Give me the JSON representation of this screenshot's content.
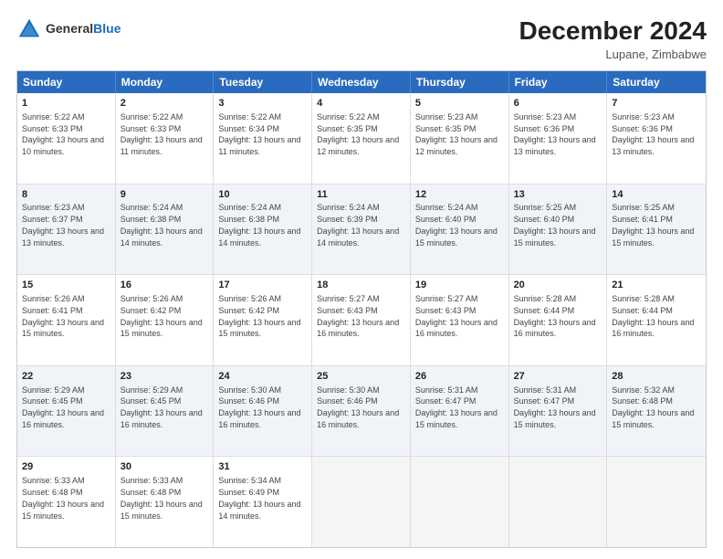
{
  "header": {
    "logo_general": "General",
    "logo_blue": "Blue",
    "month_title": "December 2024",
    "location": "Lupane, Zimbabwe"
  },
  "weekdays": [
    "Sunday",
    "Monday",
    "Tuesday",
    "Wednesday",
    "Thursday",
    "Friday",
    "Saturday"
  ],
  "rows": [
    [
      {
        "day": "1",
        "sunrise": "Sunrise: 5:22 AM",
        "sunset": "Sunset: 6:33 PM",
        "daylight": "Daylight: 13 hours and 10 minutes."
      },
      {
        "day": "2",
        "sunrise": "Sunrise: 5:22 AM",
        "sunset": "Sunset: 6:33 PM",
        "daylight": "Daylight: 13 hours and 11 minutes."
      },
      {
        "day": "3",
        "sunrise": "Sunrise: 5:22 AM",
        "sunset": "Sunset: 6:34 PM",
        "daylight": "Daylight: 13 hours and 11 minutes."
      },
      {
        "day": "4",
        "sunrise": "Sunrise: 5:22 AM",
        "sunset": "Sunset: 6:35 PM",
        "daylight": "Daylight: 13 hours and 12 minutes."
      },
      {
        "day": "5",
        "sunrise": "Sunrise: 5:23 AM",
        "sunset": "Sunset: 6:35 PM",
        "daylight": "Daylight: 13 hours and 12 minutes."
      },
      {
        "day": "6",
        "sunrise": "Sunrise: 5:23 AM",
        "sunset": "Sunset: 6:36 PM",
        "daylight": "Daylight: 13 hours and 13 minutes."
      },
      {
        "day": "7",
        "sunrise": "Sunrise: 5:23 AM",
        "sunset": "Sunset: 6:36 PM",
        "daylight": "Daylight: 13 hours and 13 minutes."
      }
    ],
    [
      {
        "day": "8",
        "sunrise": "Sunrise: 5:23 AM",
        "sunset": "Sunset: 6:37 PM",
        "daylight": "Daylight: 13 hours and 13 minutes."
      },
      {
        "day": "9",
        "sunrise": "Sunrise: 5:24 AM",
        "sunset": "Sunset: 6:38 PM",
        "daylight": "Daylight: 13 hours and 14 minutes."
      },
      {
        "day": "10",
        "sunrise": "Sunrise: 5:24 AM",
        "sunset": "Sunset: 6:38 PM",
        "daylight": "Daylight: 13 hours and 14 minutes."
      },
      {
        "day": "11",
        "sunrise": "Sunrise: 5:24 AM",
        "sunset": "Sunset: 6:39 PM",
        "daylight": "Daylight: 13 hours and 14 minutes."
      },
      {
        "day": "12",
        "sunrise": "Sunrise: 5:24 AM",
        "sunset": "Sunset: 6:40 PM",
        "daylight": "Daylight: 13 hours and 15 minutes."
      },
      {
        "day": "13",
        "sunrise": "Sunrise: 5:25 AM",
        "sunset": "Sunset: 6:40 PM",
        "daylight": "Daylight: 13 hours and 15 minutes."
      },
      {
        "day": "14",
        "sunrise": "Sunrise: 5:25 AM",
        "sunset": "Sunset: 6:41 PM",
        "daylight": "Daylight: 13 hours and 15 minutes."
      }
    ],
    [
      {
        "day": "15",
        "sunrise": "Sunrise: 5:26 AM",
        "sunset": "Sunset: 6:41 PM",
        "daylight": "Daylight: 13 hours and 15 minutes."
      },
      {
        "day": "16",
        "sunrise": "Sunrise: 5:26 AM",
        "sunset": "Sunset: 6:42 PM",
        "daylight": "Daylight: 13 hours and 15 minutes."
      },
      {
        "day": "17",
        "sunrise": "Sunrise: 5:26 AM",
        "sunset": "Sunset: 6:42 PM",
        "daylight": "Daylight: 13 hours and 15 minutes."
      },
      {
        "day": "18",
        "sunrise": "Sunrise: 5:27 AM",
        "sunset": "Sunset: 6:43 PM",
        "daylight": "Daylight: 13 hours and 16 minutes."
      },
      {
        "day": "19",
        "sunrise": "Sunrise: 5:27 AM",
        "sunset": "Sunset: 6:43 PM",
        "daylight": "Daylight: 13 hours and 16 minutes."
      },
      {
        "day": "20",
        "sunrise": "Sunrise: 5:28 AM",
        "sunset": "Sunset: 6:44 PM",
        "daylight": "Daylight: 13 hours and 16 minutes."
      },
      {
        "day": "21",
        "sunrise": "Sunrise: 5:28 AM",
        "sunset": "Sunset: 6:44 PM",
        "daylight": "Daylight: 13 hours and 16 minutes."
      }
    ],
    [
      {
        "day": "22",
        "sunrise": "Sunrise: 5:29 AM",
        "sunset": "Sunset: 6:45 PM",
        "daylight": "Daylight: 13 hours and 16 minutes."
      },
      {
        "day": "23",
        "sunrise": "Sunrise: 5:29 AM",
        "sunset": "Sunset: 6:45 PM",
        "daylight": "Daylight: 13 hours and 16 minutes."
      },
      {
        "day": "24",
        "sunrise": "Sunrise: 5:30 AM",
        "sunset": "Sunset: 6:46 PM",
        "daylight": "Daylight: 13 hours and 16 minutes."
      },
      {
        "day": "25",
        "sunrise": "Sunrise: 5:30 AM",
        "sunset": "Sunset: 6:46 PM",
        "daylight": "Daylight: 13 hours and 16 minutes."
      },
      {
        "day": "26",
        "sunrise": "Sunrise: 5:31 AM",
        "sunset": "Sunset: 6:47 PM",
        "daylight": "Daylight: 13 hours and 15 minutes."
      },
      {
        "day": "27",
        "sunrise": "Sunrise: 5:31 AM",
        "sunset": "Sunset: 6:47 PM",
        "daylight": "Daylight: 13 hours and 15 minutes."
      },
      {
        "day": "28",
        "sunrise": "Sunrise: 5:32 AM",
        "sunset": "Sunset: 6:48 PM",
        "daylight": "Daylight: 13 hours and 15 minutes."
      }
    ],
    [
      {
        "day": "29",
        "sunrise": "Sunrise: 5:33 AM",
        "sunset": "Sunset: 6:48 PM",
        "daylight": "Daylight: 13 hours and 15 minutes."
      },
      {
        "day": "30",
        "sunrise": "Sunrise: 5:33 AM",
        "sunset": "Sunset: 6:48 PM",
        "daylight": "Daylight: 13 hours and 15 minutes."
      },
      {
        "day": "31",
        "sunrise": "Sunrise: 5:34 AM",
        "sunset": "Sunset: 6:49 PM",
        "daylight": "Daylight: 13 hours and 14 minutes."
      },
      {
        "day": "",
        "sunrise": "",
        "sunset": "",
        "daylight": ""
      },
      {
        "day": "",
        "sunrise": "",
        "sunset": "",
        "daylight": ""
      },
      {
        "day": "",
        "sunrise": "",
        "sunset": "",
        "daylight": ""
      },
      {
        "day": "",
        "sunrise": "",
        "sunset": "",
        "daylight": ""
      }
    ]
  ]
}
